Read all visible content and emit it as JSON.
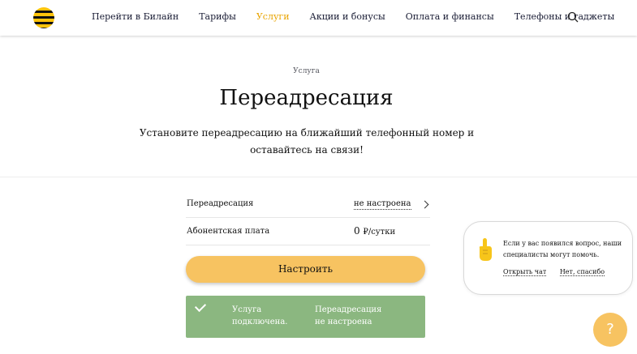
{
  "header": {
    "nav": [
      {
        "label": "Перейти в Билайн"
      },
      {
        "label": "Тарифы"
      },
      {
        "label": "Услуги"
      },
      {
        "label": "Акции и бонусы"
      },
      {
        "label": "Оплата и финансы"
      },
      {
        "label": "Телефоны и гаджеты"
      }
    ],
    "active_index": 2
  },
  "hero": {
    "eyebrow": "Услуга",
    "title": "Переадресация",
    "subtitle": "Установите переадресацию на ближайший телефонный номер и оставайтесь на связи!"
  },
  "details": {
    "forward_label": "Переадресация",
    "forward_value": "не настроена",
    "fee_label": "Абонентская плата",
    "fee_amount": "0",
    "fee_unit": "₽/сутки"
  },
  "cta": {
    "label": "Настроить"
  },
  "status": {
    "line1_a": "Услуга",
    "line1_b": "подключена.",
    "line2_a": "Переадресация",
    "line2_b": "не настроена"
  },
  "chat": {
    "message": "Если у вас появился вопрос, наши специалисты могут помочь.",
    "open_chat": "Открыть чат",
    "decline": "Нет, спасибо"
  },
  "help_button": {
    "label": "?"
  },
  "colors": {
    "accent": "#e9a400",
    "button": "#f7c361",
    "status_bg": "#8bb780"
  },
  "icons": [
    "beeline-logo-icon",
    "search-icon",
    "chevron-right-icon",
    "check-icon",
    "pointing-hand-icon"
  ]
}
